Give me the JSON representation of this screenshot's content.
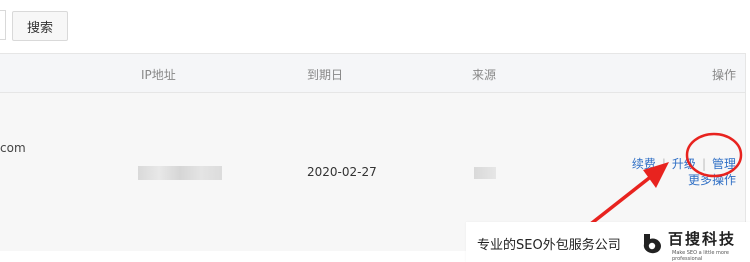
{
  "toolbar": {
    "search_label": "搜索"
  },
  "table": {
    "headers": {
      "ip": "IP地址",
      "expire": "到期日",
      "source": "来源",
      "actions": "操作"
    },
    "row": {
      "domain_partial": "com",
      "expire": "2020-02-27",
      "actions": {
        "renew": "续费",
        "upgrade": "升级",
        "manage": "管理",
        "more": "更多操作"
      }
    }
  },
  "banner": {
    "text": "专业的SEO外包服务公司",
    "brand": "百搜科技",
    "brand_sub": "Make SEO a little more professional"
  },
  "colors": {
    "link": "#2f6fc5",
    "annotation": "#e8231f"
  }
}
